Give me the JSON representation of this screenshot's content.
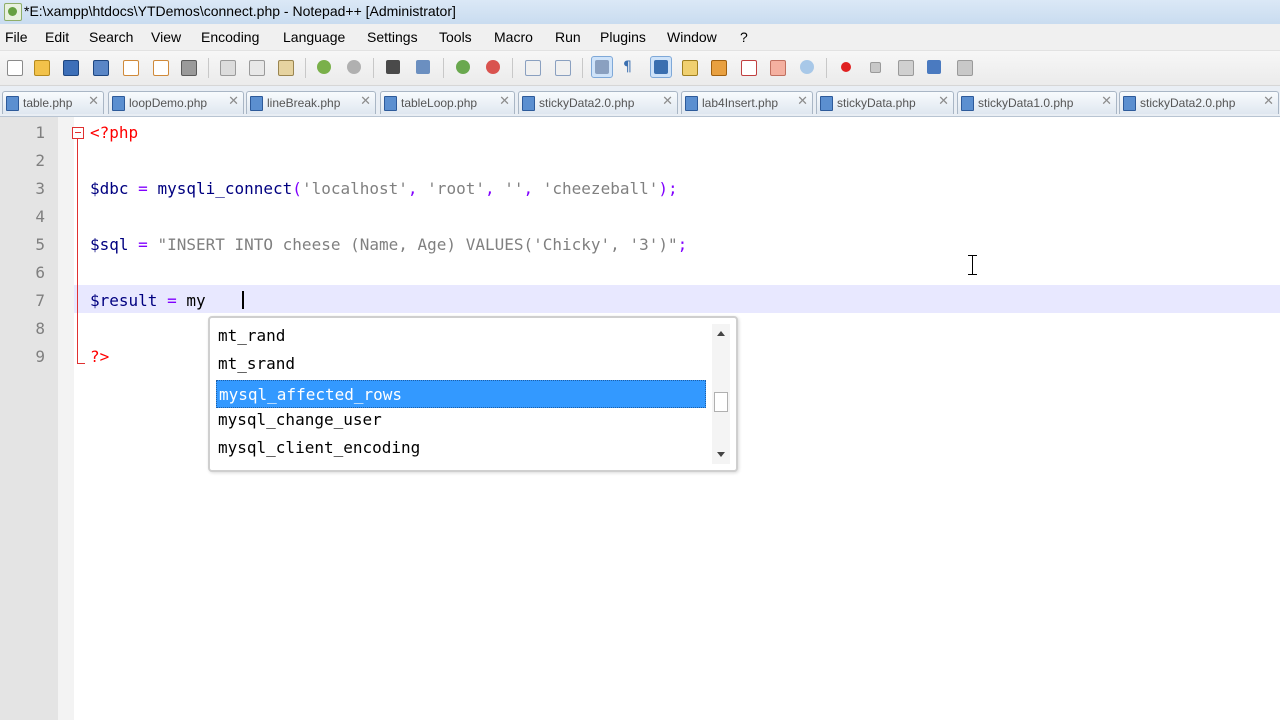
{
  "window": {
    "title": "*E:\\xampp\\htdocs\\YTDemos\\connect.php - Notepad++ [Administrator]"
  },
  "menu": [
    "File",
    "Edit",
    "Search",
    "View",
    "Encoding",
    "Language",
    "Settings",
    "Tools",
    "Macro",
    "Run",
    "Plugins",
    "Window",
    "?"
  ],
  "toolbar_icons": [
    "new-file-icon",
    "open-file-icon",
    "save-icon",
    "save-all-icon",
    "close-icon",
    "close-all-icon",
    "print-icon",
    "cut-icon",
    "copy-icon",
    "paste-icon",
    "undo-icon",
    "redo-icon",
    "find-icon",
    "replace-icon",
    "zoom-in-icon",
    "zoom-out-icon",
    "sync-vertical-icon",
    "sync-horizontal-icon",
    "word-wrap-icon",
    "show-all-characters-icon",
    "indent-guide-icon",
    "user-define-language-icon",
    "doc-map-icon",
    "function-list-icon",
    "folder-workspace-icon",
    "monitoring-icon",
    "record-macro-icon",
    "stop-recording-icon",
    "play-macro-icon",
    "run-macro-multiple-icon",
    "save-macro-icon"
  ],
  "tabs": [
    "table.php",
    "loopDemo.php",
    "lineBreak.php",
    "tableLoop.php",
    "stickyData2.0.php",
    "lab4Insert.php",
    "stickyData.php",
    "stickyData1.0.php",
    "stickyData2.0.php"
  ],
  "line_numbers": [
    "1",
    "2",
    "3",
    "4",
    "5",
    "6",
    "7",
    "8",
    "9"
  ],
  "code": {
    "line1": {
      "php_open": "<?php"
    },
    "line3": {
      "var": "$dbc",
      "eq": " = ",
      "fn": "mysqli_connect",
      "open": "(",
      "s1": "'localhost'",
      "c1": ", ",
      "s2": "'root'",
      "c2": ", ",
      "s3": "''",
      "c3": ", ",
      "s4": "'cheezeball'",
      "close": ");"
    },
    "line5": {
      "var": "$sql",
      "eq": " = ",
      "str": "\"INSERT INTO cheese (Name, Age) VALUES('Chicky', '3')\"",
      "end": ";"
    },
    "line7": {
      "var": "$result",
      "eq": " = ",
      "typed": "my"
    },
    "line9": {
      "php_close": "?>"
    }
  },
  "autocomplete": {
    "items": [
      "mt_rand",
      "mt_srand",
      "mysql_affected_rows",
      "mysql_change_user",
      "mysql_client_encoding"
    ],
    "selected": "mysql_affected_rows"
  },
  "colors": {
    "php_tag": "#ff0000",
    "variable": "#000080",
    "operator": "#8000ff",
    "string": "#808080",
    "selection": "#3399ff",
    "current_line": "#e8e8ff"
  }
}
